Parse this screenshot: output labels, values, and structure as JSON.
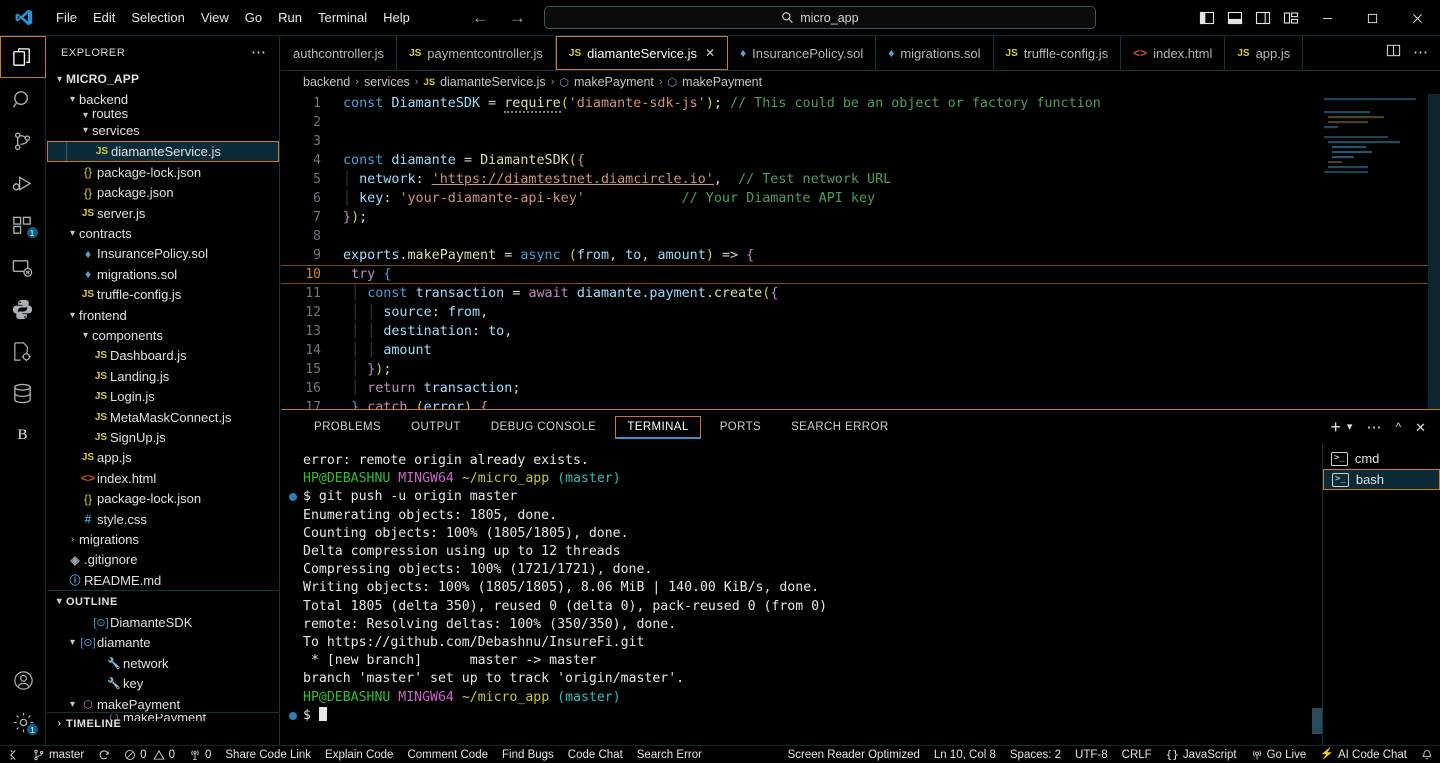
{
  "titlebar": {
    "logo_icon": "vscode-logo-icon",
    "menus": [
      "File",
      "Edit",
      "Selection",
      "View",
      "Go",
      "Run",
      "Terminal",
      "Help"
    ],
    "back_icon": "arrow-left-icon",
    "forward_icon": "arrow-right-icon",
    "search": {
      "icon": "search-icon",
      "value": "micro_app",
      "placeholder": "Search"
    },
    "layout_buttons": [
      {
        "name": "toggle-primary-sidebar-icon",
        "label": "Toggle Primary Side Bar"
      },
      {
        "name": "toggle-panel-icon",
        "label": "Toggle Panel"
      },
      {
        "name": "toggle-secondary-sidebar-icon",
        "label": "Toggle Secondary Side Bar"
      },
      {
        "name": "customize-layout-icon",
        "label": "Customize Layout"
      }
    ],
    "window_controls": [
      {
        "name": "minimize-button",
        "glyph": "—"
      },
      {
        "name": "maximize-button",
        "glyph": "❐"
      },
      {
        "name": "close-button",
        "glyph": "✕"
      }
    ]
  },
  "activitybar": {
    "items": [
      {
        "name": "explorer",
        "icon": "files-icon",
        "active": true,
        "badge": ""
      },
      {
        "name": "search",
        "icon": "search-icon",
        "active": false,
        "badge": ""
      },
      {
        "name": "source-control",
        "icon": "source-control-icon",
        "active": false,
        "badge": ""
      },
      {
        "name": "run-and-debug",
        "icon": "run-debug-icon",
        "active": false,
        "badge": ""
      },
      {
        "name": "extensions",
        "icon": "extensions-icon",
        "active": false,
        "badge": "1"
      },
      {
        "name": "remote-explorer",
        "icon": "remote-explorer-icon",
        "active": false,
        "badge": ""
      },
      {
        "name": "python",
        "icon": "python-icon",
        "active": false,
        "badge": ""
      },
      {
        "name": "code-settings",
        "icon": "file-gear-icon",
        "active": false,
        "badge": ""
      },
      {
        "name": "database",
        "icon": "database-icon",
        "active": false,
        "badge": ""
      },
      {
        "name": "blackbox",
        "icon": "letter-b-icon",
        "active": false,
        "badge": ""
      }
    ],
    "bottom": [
      {
        "name": "accounts",
        "icon": "account-icon",
        "badge": ""
      },
      {
        "name": "manage-settings",
        "icon": "gear-icon",
        "badge": "1"
      }
    ]
  },
  "sidebar": {
    "header": {
      "title": "EXPLORER",
      "more_icon": "ellipsis-icon"
    },
    "root": {
      "label": "MICRO_APP",
      "chevron": "⌄"
    },
    "tree": [
      {
        "label": "backend",
        "indent": 1,
        "type": "folder",
        "expanded": true
      },
      {
        "label": "routes",
        "indent": 2,
        "type": "folder",
        "expanded": true,
        "clipped": true
      },
      {
        "label": "services",
        "indent": 2,
        "type": "folder",
        "expanded": true
      },
      {
        "label": "diamanteService.js",
        "indent": 3,
        "type": "js",
        "selected": true
      },
      {
        "label": "package-lock.json",
        "indent": 2,
        "type": "json"
      },
      {
        "label": "package.json",
        "indent": 2,
        "type": "json"
      },
      {
        "label": "server.js",
        "indent": 2,
        "type": "js"
      },
      {
        "label": "contracts",
        "indent": 1,
        "type": "folder",
        "expanded": true
      },
      {
        "label": "InsurancePolicy.sol",
        "indent": 2,
        "type": "sol"
      },
      {
        "label": "migrations.sol",
        "indent": 2,
        "type": "sol"
      },
      {
        "label": "truffle-config.js",
        "indent": 2,
        "type": "js"
      },
      {
        "label": "frontend",
        "indent": 1,
        "type": "folder",
        "expanded": true
      },
      {
        "label": "components",
        "indent": 2,
        "type": "folder",
        "expanded": true
      },
      {
        "label": "Dashboard.js",
        "indent": 3,
        "type": "js"
      },
      {
        "label": "Landing.js",
        "indent": 3,
        "type": "js"
      },
      {
        "label": "Login.js",
        "indent": 3,
        "type": "js"
      },
      {
        "label": "MetaMaskConnect.js",
        "indent": 3,
        "type": "js"
      },
      {
        "label": "SignUp.js",
        "indent": 3,
        "type": "js"
      },
      {
        "label": "app.js",
        "indent": 2,
        "type": "js"
      },
      {
        "label": "index.html",
        "indent": 2,
        "type": "html"
      },
      {
        "label": "package-lock.json",
        "indent": 2,
        "type": "json"
      },
      {
        "label": "style.css",
        "indent": 2,
        "type": "css"
      },
      {
        "label": "migrations",
        "indent": 1,
        "type": "folder",
        "expanded": false
      },
      {
        "label": ".gitignore",
        "indent": 1,
        "type": "git"
      },
      {
        "label": "README.md",
        "indent": 1,
        "type": "md"
      }
    ],
    "outline": {
      "title": "OUTLINE",
      "items": [
        {
          "label": "DiamanteSDK",
          "indent": 2,
          "sym": "variable",
          "expanded": null
        },
        {
          "label": "diamante",
          "indent": 1,
          "sym": "variable",
          "expanded": true
        },
        {
          "label": "network",
          "indent": 3,
          "sym": "property"
        },
        {
          "label": "key",
          "indent": 3,
          "sym": "property"
        },
        {
          "label": "makePayment",
          "indent": 1,
          "sym": "method",
          "expanded": true
        },
        {
          "label": "makePayment",
          "indent": 3,
          "sym": "method",
          "clipped": true
        }
      ]
    },
    "timeline": {
      "title": "TIMELINE",
      "chevron": "›"
    }
  },
  "tabs": [
    {
      "label": "authcontroller.js",
      "icon": "",
      "active": false,
      "closable": false
    },
    {
      "label": "paymentcontroller.js",
      "icon": "js",
      "active": false,
      "closable": false
    },
    {
      "label": "diamanteService.js",
      "icon": "js",
      "active": true,
      "closable": true,
      "close_glyph": "✕"
    },
    {
      "label": "InsurancePolicy.sol",
      "icon": "sol",
      "active": false,
      "closable": false
    },
    {
      "label": "migrations.sol",
      "icon": "sol",
      "active": false,
      "closable": false
    },
    {
      "label": "truffle-config.js",
      "icon": "js",
      "active": false,
      "closable": false
    },
    {
      "label": "index.html",
      "icon": "html",
      "active": false,
      "closable": false
    },
    {
      "label": "app.js",
      "icon": "js",
      "active": false,
      "closable": false
    }
  ],
  "tab_actions": [
    {
      "name": "split-editor-right-icon"
    },
    {
      "name": "editor-actions-ellipsis-icon"
    }
  ],
  "breadcrumb": [
    {
      "label": "backend",
      "icon": ""
    },
    {
      "label": "services",
      "icon": ""
    },
    {
      "label": "diamanteService.js",
      "icon": "js"
    },
    {
      "label": "makePayment",
      "icon": "symbol-method"
    },
    {
      "label": "makePayment",
      "icon": "symbol-method"
    }
  ],
  "editor": {
    "filename": "diamanteService.js",
    "language": "JavaScript",
    "current_line": 10,
    "lines": [
      {
        "n": 1,
        "text": "const DiamanteSDK = require('diamante-sdk-js'); // This could be an object or factory function"
      },
      {
        "n": 2,
        "text": ""
      },
      {
        "n": 3,
        "text": ""
      },
      {
        "n": 4,
        "text": "const diamante = DiamanteSDK({"
      },
      {
        "n": 5,
        "text": "  network: 'https://diamtestnet.diamcircle.io',  // Test network URL"
      },
      {
        "n": 6,
        "text": "  key: 'your-diamante-api-key'            // Your Diamante API key"
      },
      {
        "n": 7,
        "text": "});"
      },
      {
        "n": 8,
        "text": ""
      },
      {
        "n": 9,
        "text": "exports.makePayment = async (from, to, amount) => {"
      },
      {
        "n": 10,
        "text": "  try {"
      },
      {
        "n": 11,
        "text": "    const transaction = await diamante.payment.create({"
      },
      {
        "n": 12,
        "text": "      source: from,"
      },
      {
        "n": 13,
        "text": "      destination: to,"
      },
      {
        "n": 14,
        "text": "      amount"
      },
      {
        "n": 15,
        "text": "    });"
      },
      {
        "n": 16,
        "text": "    return transaction;"
      },
      {
        "n": 17,
        "text": "  } catch (error) {"
      }
    ]
  },
  "panel": {
    "tabs": [
      {
        "label": "PROBLEMS",
        "active": false
      },
      {
        "label": "OUTPUT",
        "active": false
      },
      {
        "label": "DEBUG CONSOLE",
        "active": false
      },
      {
        "label": "TERMINAL",
        "active": true
      },
      {
        "label": "PORTS",
        "active": false
      },
      {
        "label": "SEARCH ERROR",
        "active": false
      }
    ],
    "actions": [
      {
        "name": "new-terminal-icon",
        "glyph": "＋"
      },
      {
        "name": "terminal-dropdown-icon",
        "glyph": "⌄"
      },
      {
        "name": "panel-views-ellipsis-icon",
        "glyph": "⋯"
      },
      {
        "name": "maximize-panel-icon",
        "glyph": "∧"
      },
      {
        "name": "close-panel-icon",
        "glyph": "✕"
      }
    ],
    "terminal_tabs": [
      {
        "label": "cmd",
        "icon": "terminal-icon",
        "selected": false
      },
      {
        "label": "bash",
        "icon": "terminal-icon",
        "selected": true
      }
    ],
    "terminal_lines": [
      {
        "segs": [
          {
            "t": "error: remote origin already exists.",
            "c": "white"
          }
        ]
      },
      {
        "segs": [
          {
            "t": "",
            "c": "white"
          }
        ]
      },
      {
        "segs": [
          {
            "t": "HP@DEBASHNU",
            "c": "green"
          },
          {
            "t": " ",
            "c": "white"
          },
          {
            "t": "MINGW64",
            "c": "purple"
          },
          {
            "t": " ",
            "c": "white"
          },
          {
            "t": "~/micro_app",
            "c": "yellow"
          },
          {
            "t": " ",
            "c": "white"
          },
          {
            "t": "(master)",
            "c": "cyan"
          }
        ]
      },
      {
        "segs": [
          {
            "t": "$ git push -u origin master",
            "c": "white"
          }
        ],
        "mark": true
      },
      {
        "segs": [
          {
            "t": "Enumerating objects: 1805, done.",
            "c": "white"
          }
        ]
      },
      {
        "segs": [
          {
            "t": "Counting objects: 100% (1805/1805), done.",
            "c": "white"
          }
        ]
      },
      {
        "segs": [
          {
            "t": "Delta compression using up to 12 threads",
            "c": "white"
          }
        ]
      },
      {
        "segs": [
          {
            "t": "Compressing objects: 100% (1721/1721), done.",
            "c": "white"
          }
        ]
      },
      {
        "segs": [
          {
            "t": "Writing objects: 100% (1805/1805), 8.06 MiB | 140.00 KiB/s, done.",
            "c": "white"
          }
        ]
      },
      {
        "segs": [
          {
            "t": "Total 1805 (delta 350), reused 0 (delta 0), pack-reused 0 (from 0)",
            "c": "white"
          }
        ]
      },
      {
        "segs": [
          {
            "t": "remote: Resolving deltas: 100% (350/350), done.",
            "c": "white"
          }
        ]
      },
      {
        "segs": [
          {
            "t": "To https://github.com/Debashnu/InsureFi.git",
            "c": "white"
          }
        ]
      },
      {
        "segs": [
          {
            "t": " * [new branch]      master -> master",
            "c": "white"
          }
        ]
      },
      {
        "segs": [
          {
            "t": "branch 'master' set up to track 'origin/master'.",
            "c": "white"
          }
        ]
      },
      {
        "segs": [
          {
            "t": "",
            "c": "white"
          }
        ]
      },
      {
        "segs": [
          {
            "t": "HP@DEBASHNU",
            "c": "green"
          },
          {
            "t": " ",
            "c": "white"
          },
          {
            "t": "MINGW64",
            "c": "purple"
          },
          {
            "t": " ",
            "c": "white"
          },
          {
            "t": "~/micro_app",
            "c": "yellow"
          },
          {
            "t": " ",
            "c": "white"
          },
          {
            "t": "(master)",
            "c": "cyan"
          }
        ]
      },
      {
        "segs": [
          {
            "t": "$ ",
            "c": "white"
          }
        ],
        "cursor": true,
        "mark2": true
      }
    ]
  },
  "statusbar": {
    "left": [
      {
        "name": "remote-window-button",
        "icon": "remote-icon",
        "label": ""
      },
      {
        "name": "branch-button",
        "icon": "git-branch-icon",
        "label": "master"
      },
      {
        "name": "sync-button",
        "icon": "sync-icon",
        "label": ""
      },
      {
        "name": "errors-warnings-button",
        "icon": "error-warning-icon",
        "label": "0  0",
        "errors": "0",
        "warnings": "0"
      },
      {
        "name": "ports-button",
        "icon": "radio-tower-icon",
        "label": "0"
      },
      {
        "name": "share-code-link-button",
        "icon": "",
        "label": "Share Code Link"
      },
      {
        "name": "explain-code-button",
        "icon": "",
        "label": "Explain Code"
      },
      {
        "name": "comment-code-button",
        "icon": "",
        "label": "Comment Code"
      },
      {
        "name": "find-bugs-button",
        "icon": "",
        "label": "Find Bugs"
      },
      {
        "name": "code-chat-button",
        "icon": "",
        "label": "Code Chat"
      },
      {
        "name": "search-error-button",
        "icon": "",
        "label": "Search Error"
      }
    ],
    "right": [
      {
        "name": "screen-reader-button",
        "icon": "",
        "label": "Screen Reader Optimized"
      },
      {
        "name": "cursor-position-button",
        "icon": "",
        "label": "Ln 10, Col 8"
      },
      {
        "name": "indentation-button",
        "icon": "",
        "label": "Spaces: 2"
      },
      {
        "name": "encoding-button",
        "icon": "",
        "label": "UTF-8"
      },
      {
        "name": "eol-button",
        "icon": "",
        "label": "CRLF"
      },
      {
        "name": "language-mode-button",
        "icon": "json-braces-icon",
        "label": "JavaScript"
      },
      {
        "name": "go-live-button",
        "icon": "broadcast-icon",
        "label": "Go Live"
      },
      {
        "name": "ai-code-chat-button",
        "icon": "zap-icon",
        "label": "AI Code Chat"
      },
      {
        "name": "notifications-button",
        "icon": "bell-icon",
        "label": ""
      }
    ]
  },
  "colors": {
    "background": "#000000",
    "accent_orange": "#c87b2c",
    "accent_blue": "#3794d4",
    "border": "#11333f"
  }
}
